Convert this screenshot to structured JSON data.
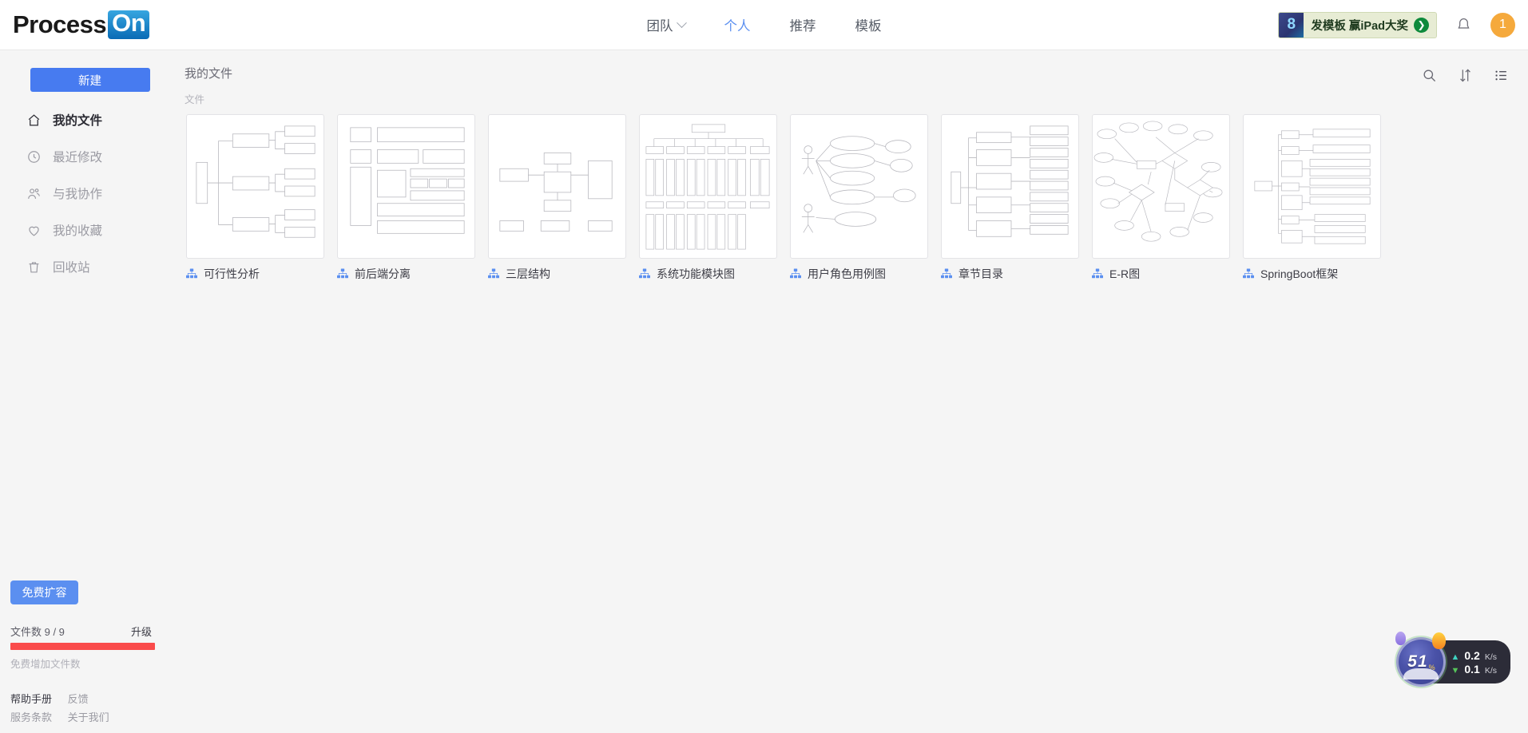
{
  "brand": {
    "part1": "Process",
    "part2": "On"
  },
  "topnav": {
    "items": [
      {
        "label": "团队",
        "has_caret": true,
        "active": false
      },
      {
        "label": "个人",
        "has_caret": false,
        "active": true
      },
      {
        "label": "推荐",
        "has_caret": false,
        "active": false
      },
      {
        "label": "模板",
        "has_caret": false,
        "active": false
      }
    ],
    "promo": {
      "text": "发模板 赢iPad大奖",
      "arrow": "❯",
      "thumb_glyph": "8"
    },
    "bell_icon": "bell-icon",
    "avatar_text": "1"
  },
  "sidebar": {
    "new_button": "新建",
    "items": [
      {
        "label": "我的文件",
        "icon": "home-icon",
        "active": true
      },
      {
        "label": "最近修改",
        "icon": "clock-icon",
        "active": false
      },
      {
        "label": "与我协作",
        "icon": "people-icon",
        "active": false
      },
      {
        "label": "我的收藏",
        "icon": "heart-icon",
        "active": false
      },
      {
        "label": "回收站",
        "icon": "trash-icon",
        "active": false
      }
    ],
    "expand_button": "免费扩容",
    "quota_label": "文件数 9 / 9",
    "quota_upgrade": "升级",
    "quota_percent": 100,
    "quota_note": "免费增加文件数",
    "footer_links": [
      {
        "label": "帮助手册",
        "dark": true
      },
      {
        "label": "反馈",
        "dark": false
      },
      {
        "label": "服务条款",
        "dark": false
      },
      {
        "label": "关于我们",
        "dark": false
      }
    ]
  },
  "main": {
    "breadcrumb": "我的文件",
    "subtitle": "文件",
    "tools": [
      {
        "name": "search-icon",
        "label": "搜索"
      },
      {
        "name": "sort-icon",
        "label": "排序"
      },
      {
        "name": "list-view-icon",
        "label": "列表视图"
      }
    ],
    "files": [
      {
        "name": "可行性分析",
        "icon": "org-chart-icon",
        "thumb": "tree3"
      },
      {
        "name": "前后端分离",
        "icon": "org-chart-icon",
        "thumb": "boxes"
      },
      {
        "name": "三层结构",
        "icon": "org-chart-icon",
        "thumb": "flow"
      },
      {
        "name": "系统功能模块图",
        "icon": "org-chart-icon",
        "thumb": "orgwide"
      },
      {
        "name": "用户角色用例图",
        "icon": "org-chart-icon",
        "thumb": "usecase"
      },
      {
        "name": "章节目录",
        "icon": "org-chart-icon",
        "thumb": "toc"
      },
      {
        "name": "E-R图",
        "icon": "org-chart-icon",
        "thumb": "er"
      },
      {
        "name": "SpringBoot框架",
        "icon": "org-chart-icon",
        "thumb": "springboot"
      }
    ]
  },
  "net_widget": {
    "gauge_value": "51",
    "gauge_unit": "%",
    "upload": {
      "value": "0.2",
      "unit": "K/s",
      "arrow": "▲"
    },
    "download": {
      "value": "0.1",
      "unit": "K/s",
      "arrow": "▼"
    }
  },
  "colors": {
    "accent_blue": "#477bf0",
    "logo_blue": "#0a6bb5",
    "quota_red": "#fa4b4b",
    "avatar_orange": "#f5a93c",
    "promo_green": "#0e8a3c"
  }
}
